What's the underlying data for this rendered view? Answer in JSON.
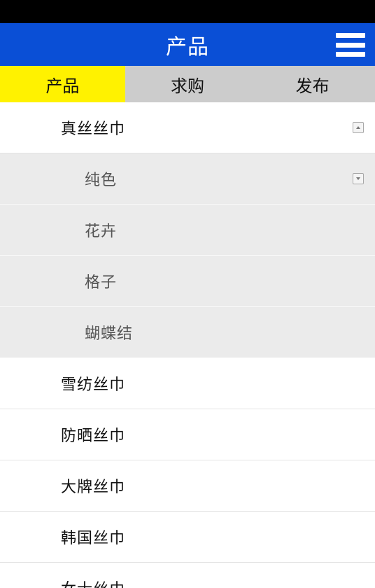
{
  "header": {
    "title": "产品",
    "menu_icon": "hamburger-menu-icon"
  },
  "tabs": [
    {
      "label": "产品",
      "active": true
    },
    {
      "label": "求购",
      "active": false
    },
    {
      "label": "发布",
      "active": false
    }
  ],
  "categories": [
    {
      "label": "真丝丝巾",
      "expanded": true,
      "children": [
        {
          "label": "纯色",
          "expanded": false
        },
        {
          "label": "花卉"
        },
        {
          "label": "格子"
        },
        {
          "label": "蝴蝶结"
        }
      ]
    },
    {
      "label": "雪纺丝巾"
    },
    {
      "label": "防晒丝巾"
    },
    {
      "label": "大牌丝巾"
    },
    {
      "label": "韩国丝巾"
    },
    {
      "label": "女士丝巾"
    }
  ],
  "colors": {
    "status_bar": "#000000",
    "header_bg": "#0a4fd6",
    "tab_active_bg": "#fff200",
    "tab_bg": "#cccccc",
    "sub_row_bg": "#ebebeb"
  }
}
